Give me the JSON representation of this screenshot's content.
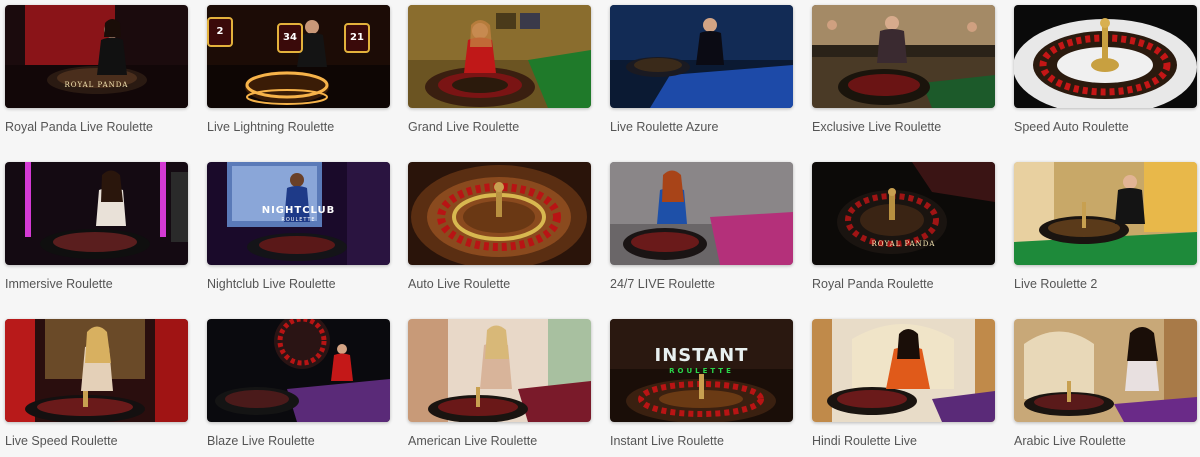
{
  "games": [
    {
      "title": "Royal Panda Live Roulette",
      "scene": "royal-panda-dark",
      "overlay": "ROYAL PANDA"
    },
    {
      "title": "Live Lightning Roulette",
      "scene": "lightning",
      "badges": [
        "2",
        "34",
        "21"
      ]
    },
    {
      "title": "Grand Live Roulette",
      "scene": "grand"
    },
    {
      "title": "Live Roulette Azure",
      "scene": "azure"
    },
    {
      "title": "Exclusive Live Roulette",
      "scene": "exclusive"
    },
    {
      "title": "Speed Auto Roulette",
      "scene": "speed-auto"
    },
    {
      "title": "Immersive Roulette",
      "scene": "immersive"
    },
    {
      "title": "Nightclub Live Roulette",
      "scene": "nightclub",
      "overlay": "NIGHTCLUB",
      "overlay_sub": "ROULETTE"
    },
    {
      "title": "Auto Live Roulette",
      "scene": "auto-wheel"
    },
    {
      "title": "24/7 LIVE Roulette",
      "scene": "twentyfour"
    },
    {
      "title": "Royal Panda Roulette",
      "scene": "royal-panda-wheel",
      "overlay": "ROYAL PANDA"
    },
    {
      "title": "Live Roulette 2",
      "scene": "roulette2"
    },
    {
      "title": "Live Speed Roulette",
      "scene": "speed"
    },
    {
      "title": "Blaze Live Roulette",
      "scene": "blaze"
    },
    {
      "title": "American Live Roulette",
      "scene": "american"
    },
    {
      "title": "Instant Live Roulette",
      "scene": "instant",
      "overlay": "INSTANT",
      "overlay_sub": "ROULETTE"
    },
    {
      "title": "Hindi Roulette Live",
      "scene": "hindi"
    },
    {
      "title": "Arabic Live Roulette",
      "scene": "arabic"
    }
  ]
}
